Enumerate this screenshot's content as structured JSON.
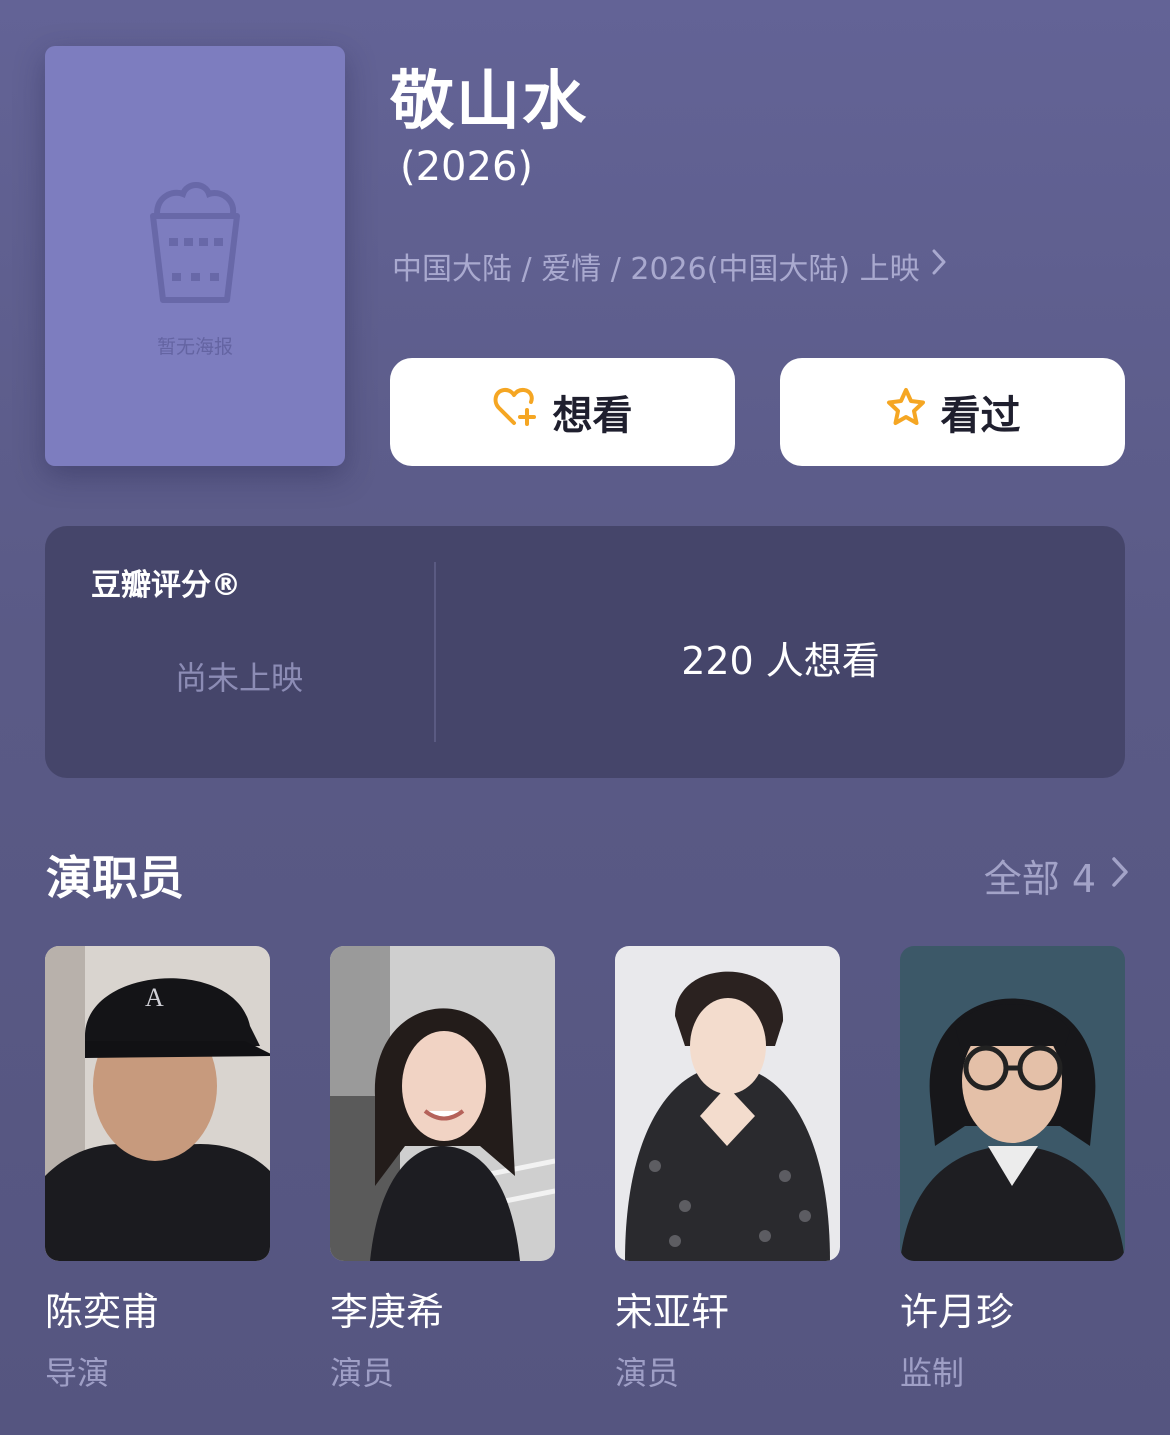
{
  "movie": {
    "title": "敬山水",
    "year": "(2026)",
    "meta": "中国大陆 / 爱情 / 2026(中国大陆) 上映",
    "poster_placeholder": "暂无海报"
  },
  "actions": {
    "want_label": "想看",
    "seen_label": "看过"
  },
  "rating": {
    "title": "豆瓣评分®",
    "status": "尚未上映",
    "want_count": "220 人想看"
  },
  "cast_section": {
    "title": "演职员",
    "see_all": "全部 4"
  },
  "cast": [
    {
      "name": "陈奕甫",
      "role": "导演"
    },
    {
      "name": "李庚希",
      "role": "演员"
    },
    {
      "name": "宋亚轩",
      "role": "演员"
    },
    {
      "name": "许月珍",
      "role": "监制"
    }
  ],
  "colors": {
    "background": "#5b5b87",
    "poster": "#7d7dbf",
    "card": "#45456a",
    "accent": "#f5a623"
  },
  "icons": [
    "popcorn-icon",
    "heart-plus-icon",
    "star-icon",
    "chevron-right-icon"
  ]
}
